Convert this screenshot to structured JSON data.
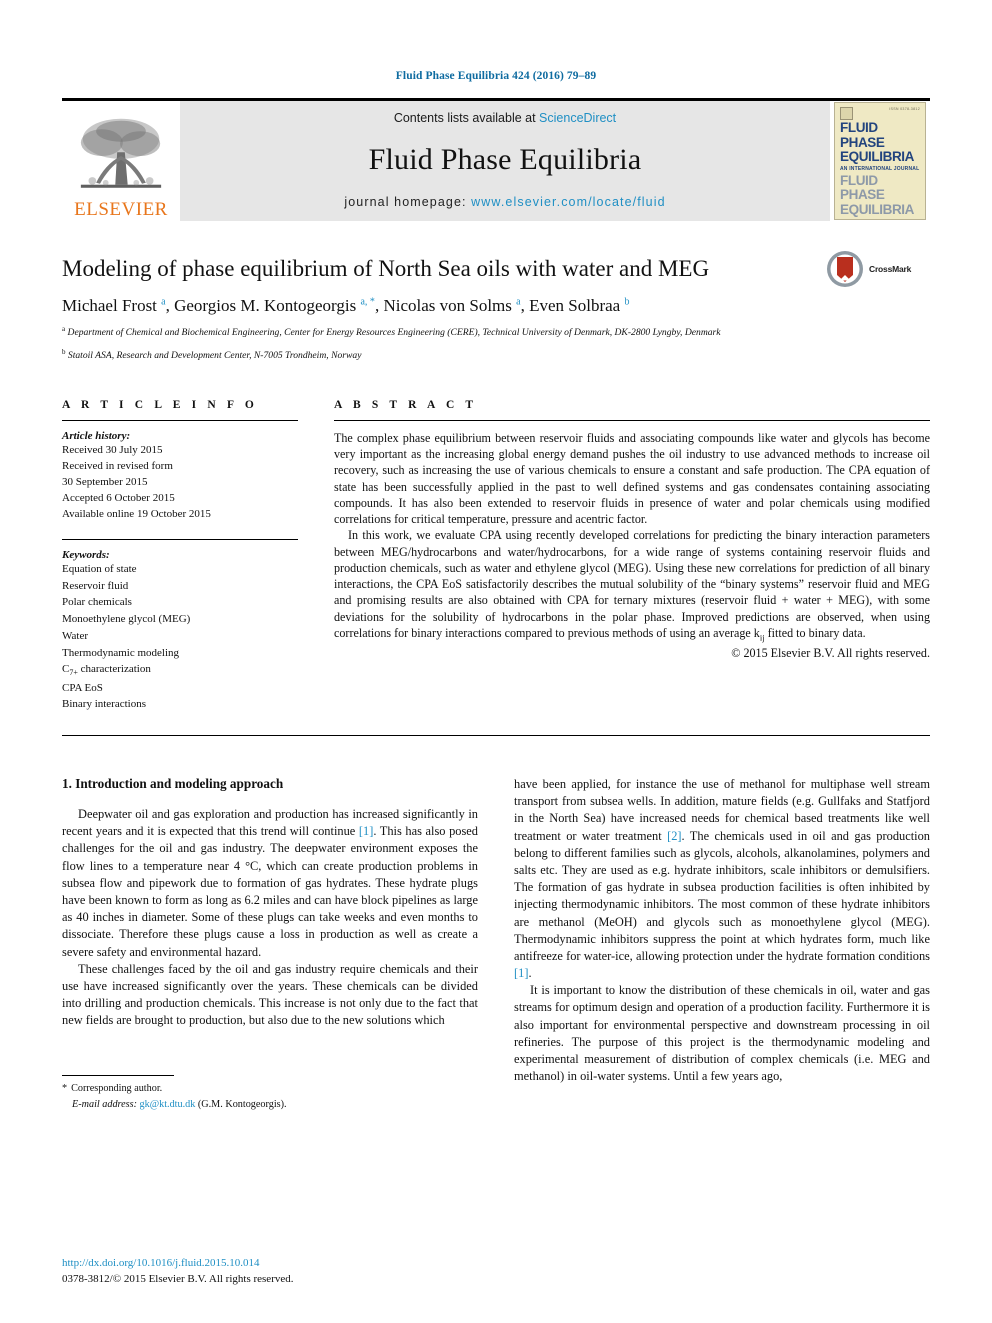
{
  "running_head": "Fluid Phase Equilibria 424 (2016) 79–89",
  "masthead": {
    "publisher_logo_name": "elsevier-tree-logo",
    "publisher_wordmark": "ELSEVIER",
    "contents_prefix": "Contents lists available at ",
    "contents_link": "ScienceDirect",
    "journal_title": "Fluid Phase Equilibria",
    "homepage_prefix": "journal homepage: ",
    "homepage_url": "www.elsevier.com/locate/fluid",
    "cover": {
      "tag": "ISSN 0378-3812",
      "line1": "FLUID PHASE",
      "line2": "EQUILIBRIA",
      "subtitle": "AN INTERNATIONAL JOURNAL",
      "line3": "FLUID PHASE",
      "line4": "EQUILIBRIA"
    }
  },
  "article": {
    "title": "Modeling of phase equilibrium of North Sea oils with water and MEG",
    "crossmark_label": "CrossMark",
    "authors": [
      {
        "name": "Michael Frost",
        "marks": "a"
      },
      {
        "name": "Georgios M. Kontogeorgis",
        "marks": "a, *"
      },
      {
        "name": "Nicolas von Solms",
        "marks": "a"
      },
      {
        "name": "Even Solbraa",
        "marks": "b"
      }
    ],
    "authors_line": "Michael Frost a, Georgios M. Kontogeorgis a, *, Nicolas von Solms a, Even Solbraa b",
    "affiliations": [
      {
        "mark": "a",
        "text": "Department of Chemical and Biochemical Engineering, Center for Energy Resources Engineering (CERE), Technical University of Denmark, DK-2800 Lyngby, Denmark"
      },
      {
        "mark": "b",
        "text": "Statoil ASA, Research and Development Center, N-7005 Trondheim, Norway"
      }
    ]
  },
  "article_info": {
    "heading": "A R T I C L E   I N F O",
    "history_label": "Article history:",
    "history": [
      "Received 30 July 2015",
      "Received in revised form",
      "30 September 2015",
      "Accepted 6 October 2015",
      "Available online 19 October 2015"
    ],
    "keywords_label": "Keywords:",
    "keywords": [
      "Equation of state",
      "Reservoir fluid",
      "Polar chemicals",
      "Monoethylene glycol (MEG)",
      "Water",
      "Thermodynamic modeling",
      "C7+ characterization",
      "CPA EoS",
      "Binary interactions"
    ]
  },
  "abstract": {
    "heading": "A B S T R A C T",
    "paragraphs": [
      "The complex phase equilibrium between reservoir fluids and associating compounds like water and glycols has become very important as the increasing global energy demand pushes the oil industry to use advanced methods to increase oil recovery, such as increasing the use of various chemicals to ensure a constant and safe production. The CPA equation of state has been successfully applied in the past to well defined systems and gas condensates containing associating compounds. It has also been extended to reservoir fluids in presence of water and polar chemicals using modified correlations for critical temperature, pressure and acentric factor.",
      "In this work, we evaluate CPA using recently developed correlations for predicting the binary interaction parameters between MEG/hydrocarbons and water/hydrocarbons, for a wide range of systems containing reservoir fluids and production chemicals, such as water and ethylene glycol (MEG). Using these new correlations for prediction of all binary interactions, the CPA EoS satisfactorily describes the mutual solubility of the “binary systems” reservoir fluid and MEG and promising results are also obtained with CPA for ternary mixtures (reservoir fluid + water + MEG), with some deviations for the solubility of hydrocarbons in the polar phase. Improved predictions are observed, when using correlations for binary interactions compared to previous methods of using an average kij fitted to binary data."
    ],
    "copyright": "© 2015 Elsevier B.V. All rights reserved."
  },
  "body": {
    "section_heading": "1. Introduction and modeling approach",
    "left_paragraphs": [
      "Deepwater oil and gas exploration and production has increased significantly in recent years and it is expected that this trend will continue [1]. This has also posed challenges for the oil and gas industry. The deepwater environment exposes the flow lines to a temperature near 4 °C, which can create production problems in subsea flow and pipework due to formation of gas hydrates. These hydrate plugs have been known to form as long as 6.2 miles and can have block pipelines as large as 40 inches in diameter. Some of these plugs can take weeks and even months to dissociate. Therefore these plugs cause a loss in production as well as create a severe safety and environmental hazard.",
      "These challenges faced by the oil and gas industry require chemicals and their use have increased significantly over the years. These chemicals can be divided into drilling and production chemicals. This increase is not only due to the fact that new fields are brought to production, but also due to the new solutions which"
    ],
    "right_paragraphs": [
      "have been applied, for instance the use of methanol for multiphase well stream transport from subsea wells. In addition, mature fields (e.g. Gullfaks and Statfjord in the North Sea) have increased needs for chemical based treatments like well treatment or water treatment [2]. The chemicals used in oil and gas production belong to different families such as glycols, alcohols, alkanolamines, polymers and salts etc. They are used as e.g. hydrate inhibitors, scale inhibitors or demulsifiers. The formation of gas hydrate in subsea production facilities is often inhibited by injecting thermodynamic inhibitors. The most common of these hydrate inhibitors are methanol (MeOH) and glycols such as monoethylene glycol (MEG). Thermodynamic inhibitors suppress the point at which hydrates form, much like antifreeze for water-ice, allowing protection under the hydrate formation conditions [1].",
      "It is important to know the distribution of these chemicals in oil, water and gas streams for optimum design and operation of a production facility. Furthermore it is also important for environmental perspective and downstream processing in oil refineries. The purpose of this project is the thermodynamic modeling and experimental measurement of distribution of complex chemicals (i.e. MEG and methanol) in oil-water systems. Until a few years ago,"
    ]
  },
  "footnote": {
    "corresponding": "Corresponding author.",
    "email_label": "E-mail address:",
    "email": "gk@kt.dtu.dk",
    "email_owner": "(G.M. Kontogeorgis)."
  },
  "page_footer": {
    "doi": "http://dx.doi.org/10.1016/j.fluid.2015.10.014",
    "issn_copyright": "0378-3812/© 2015 Elsevier B.V. All rights reserved."
  },
  "colors": {
    "link_blue": "#1f8fc4",
    "head_blue": "#0e6ba0",
    "elsevier_orange": "#E8761C",
    "band_gray": "#e6e6e6"
  }
}
